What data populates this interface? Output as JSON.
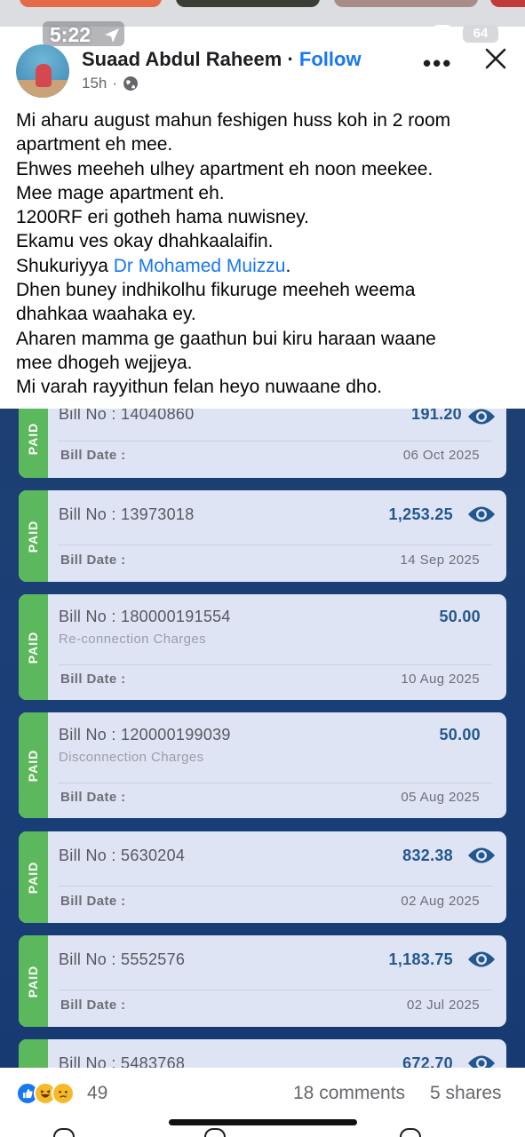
{
  "status_bar": {
    "time": "5:22",
    "battery": "64"
  },
  "post": {
    "author": "Suaad Abdul Raheem",
    "separator": "·",
    "follow_label": "Follow",
    "time_ago": "15h",
    "time_sep": "·",
    "lines": [
      "Mi aharu august mahun feshigen huss koh in 2 room",
      "apartment eh mee.",
      "Ehwes meeheh ulhey apartment eh noon meekee.",
      "Mee mage apartment eh.",
      "1200RF eri gotheh hama nuwisney.",
      "Ekamu ves okay dhahkaalaifin.",
      "Shukuriyya ",
      "Dhen buney indhikolhu fikuruge meeheh weema",
      "dhahkaa waahaka ey.",
      "Aharen mamma ge gaathun bui kiru haraan waane",
      "mee dhogeh wejjeya.",
      "Mi varah rayyithun felan heyo nuwaane dho."
    ],
    "mention": "Dr Mohamed Muizzu",
    "mention_suffix": "."
  },
  "bills": {
    "paid_label": "PAID",
    "date_label": "Bill Date :",
    "items": [
      {
        "bill_no": "Bill No : 14040860",
        "amount": "191.20",
        "date": "06 Oct 2025"
      },
      {
        "bill_no": "Bill No : 13973018",
        "amount": "1,253.25",
        "date": "14 Sep 2025"
      },
      {
        "bill_no": "Bill No : 180000191554",
        "amount": "50.00",
        "desc": "Re-connection Charges",
        "date": "10 Aug 2025"
      },
      {
        "bill_no": "Bill No : 120000199039",
        "amount": "50.00",
        "desc": "Disconnection Charges",
        "date": "05 Aug 2025"
      },
      {
        "bill_no": "Bill No : 5630204",
        "amount": "832.38",
        "date": "02 Aug 2025"
      },
      {
        "bill_no": "Bill No : 5552576",
        "amount": "1,183.75",
        "date": "02 Jul 2025"
      },
      {
        "bill_no": "Bill No : 5483768",
        "amount": "672.70"
      }
    ]
  },
  "reactions": {
    "count": "49",
    "comments": "18 comments",
    "shares": "5 shares",
    "colors": {
      "like": "#1877f2",
      "haha": "#f7b928",
      "sad": "#f7b928"
    }
  },
  "colors": {
    "paid": "#5cb85c",
    "amount": "#23578f",
    "link": "#1877f2",
    "background": "#1d3f72"
  }
}
